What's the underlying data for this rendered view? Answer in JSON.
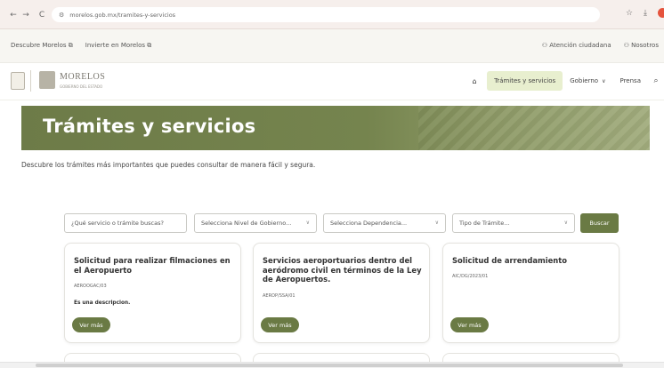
{
  "browser": {
    "url": "morelos.gob.mx/tramites-y-servicios",
    "back": "←",
    "forward": "→",
    "reload": "C",
    "star": "☆",
    "download": "⤓"
  },
  "util_bar": {
    "links": [
      "Descubre Morelos",
      "Invierte en Morelos"
    ],
    "atencion": "Atención ciudadana",
    "nosotros": "Nosotros"
  },
  "header": {
    "logo_text": "MORELOS",
    "logo_sub": "GOBIERNO DEL ESTADO",
    "nav": {
      "tramites": "Trámites y servicios",
      "gobierno": "Gobierno",
      "prensa": "Prensa"
    }
  },
  "hero": {
    "title": "Trámites y servicios"
  },
  "intro": "Descubre los trámites más importantes que puedes consultar de manera fácil y segura.",
  "filters": {
    "search_placeholder": "¿Qué servicio o trámite buscas?",
    "nivel": "Selecciona Nivel de Gobierno...",
    "dependencia": "Selecciona Dependencia...",
    "tipo": "Tipo de Trámite...",
    "buscar": "Buscar"
  },
  "cards": [
    {
      "title": "Solicitud para realizar filmaciones en el Aeropuerto",
      "code": "AEROOGAC/03",
      "desc": "Es una descripcion.",
      "button": "Ver más"
    },
    {
      "title": "Servicios aeroportuarios dentro del aeródromo civil en términos de la Ley de Aeropuertos.",
      "code": "AEROP/SSA/01",
      "desc": "",
      "button": "Ver más"
    },
    {
      "title": "Solicitud de arrendamiento",
      "code": "AIC/DG/2023/01",
      "desc": "",
      "button": "Ver más"
    }
  ],
  "icons": {
    "home": "home-icon",
    "search": "search-icon",
    "user": "user-icon",
    "external": "external-link-icon"
  },
  "colors": {
    "primary": "#6a7a44",
    "hero": "#75844e",
    "nav_active_bg": "#e8efcf"
  }
}
